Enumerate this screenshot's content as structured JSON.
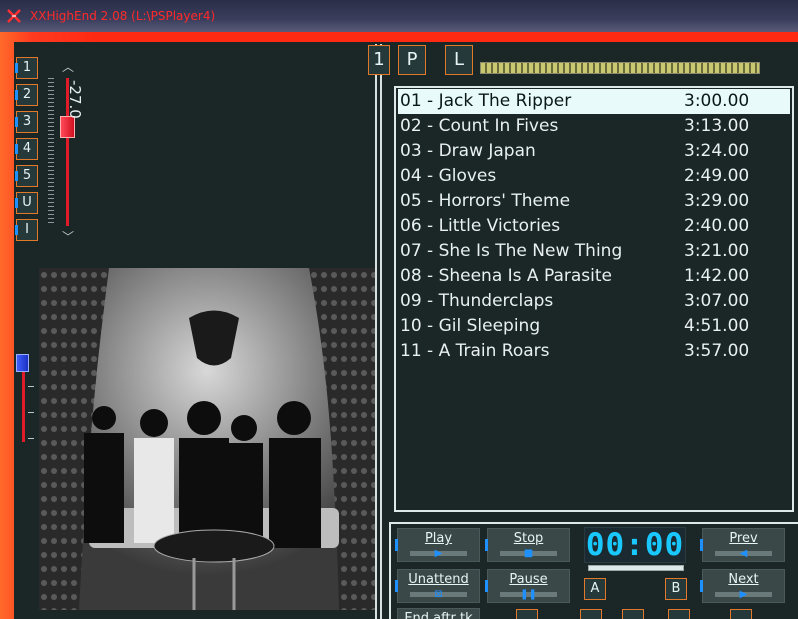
{
  "window": {
    "title": "XXHighEnd 2.08 (L:\\PSPlayer4)"
  },
  "presets": [
    "1",
    "2",
    "3",
    "4",
    "5",
    "U",
    "I"
  ],
  "volume": {
    "readout": "-27.0",
    "level": 0.33
  },
  "balance": {
    "level": 0.0
  },
  "top_buttons": {
    "album_index": "1",
    "playlist_button": "P",
    "library_button": "L"
  },
  "tracks": [
    {
      "title": "01 - Jack The Ripper",
      "duration": "3:00.00"
    },
    {
      "title": "02 - Count In Fives",
      "duration": "3:13.00"
    },
    {
      "title": "03 - Draw Japan",
      "duration": "3:24.00"
    },
    {
      "title": "04 - Gloves",
      "duration": "2:49.00"
    },
    {
      "title": "05 - Horrors' Theme",
      "duration": "3:29.00"
    },
    {
      "title": "06 - Little Victories",
      "duration": "2:40.00"
    },
    {
      "title": "07 - She Is The New Thing",
      "duration": "3:21.00"
    },
    {
      "title": "08 - Sheena Is A Parasite",
      "duration": "1:42.00"
    },
    {
      "title": "09 - Thunderclaps",
      "duration": "3:07.00"
    },
    {
      "title": "10 - Gil Sleeping",
      "duration": "4:51.00"
    },
    {
      "title": "11 - A Train Roars",
      "duration": "3:57.00"
    }
  ],
  "selected_track_index": 0,
  "transport": {
    "play": "Play",
    "stop": "Stop",
    "prev": "Prev",
    "unattend": "Unattend",
    "pause": "Pause",
    "next": "Next",
    "end_after_track": "End aftr tk",
    "a_button": "A",
    "b_button": "B",
    "clock": "00:00"
  },
  "colors": {
    "accent": "#1e90ff",
    "frame": "#ff2a12",
    "button_border": "#e07a2a",
    "clock": "#19c8ff"
  }
}
